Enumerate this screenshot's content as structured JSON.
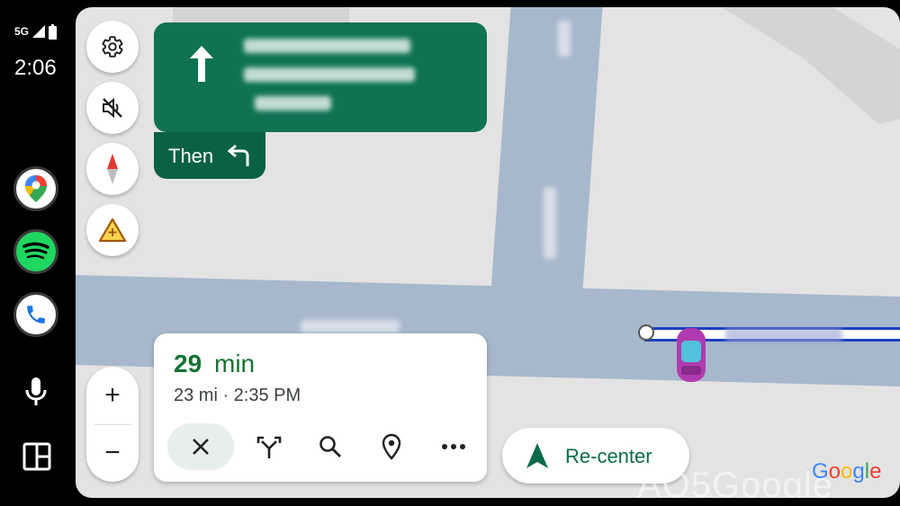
{
  "status": {
    "network": "5G",
    "time": "2:06"
  },
  "rail": {
    "apps": [
      {
        "name": "Google Maps",
        "icon": "maps-pin-icon"
      },
      {
        "name": "Spotify",
        "icon": "spotify-icon"
      },
      {
        "name": "Phone",
        "icon": "phone-icon"
      }
    ],
    "mic_icon": "microphone-icon",
    "dashboard_icon": "dashboard-grid-icon"
  },
  "map_controls": {
    "settings_icon": "gear-icon",
    "mute_icon": "sound-off-icon",
    "compass_icon": "compass-icon",
    "report_icon": "report-hazard-icon",
    "zoom_in": "+",
    "zoom_out": "−"
  },
  "guidance": {
    "maneuver_icon": "arrow-up-icon",
    "then_label": "Then",
    "then_icon": "turn-left-icon"
  },
  "trip": {
    "eta_minutes": "29",
    "eta_unit": "min",
    "details": "23 mi · 2:35 PM",
    "actions": [
      "close-icon",
      "alternate-routes-icon",
      "search-icon",
      "location-pin-icon",
      "more-icon"
    ]
  },
  "recenter": {
    "label": "Re-center",
    "icon": "navigation-arrow-icon"
  },
  "brand": {
    "letters": [
      "G",
      "o",
      "o",
      "g",
      "l",
      "e"
    ],
    "colors": [
      "#4285f4",
      "#ea4335",
      "#fbbc05",
      "#4285f4",
      "#34a853",
      "#ea4335"
    ]
  },
  "watermark": "AO5Google",
  "colors": {
    "guidance_green": "#0f7353",
    "eta_green": "#137333",
    "road": "#a8b8cc",
    "route": "#1a3fbf"
  }
}
